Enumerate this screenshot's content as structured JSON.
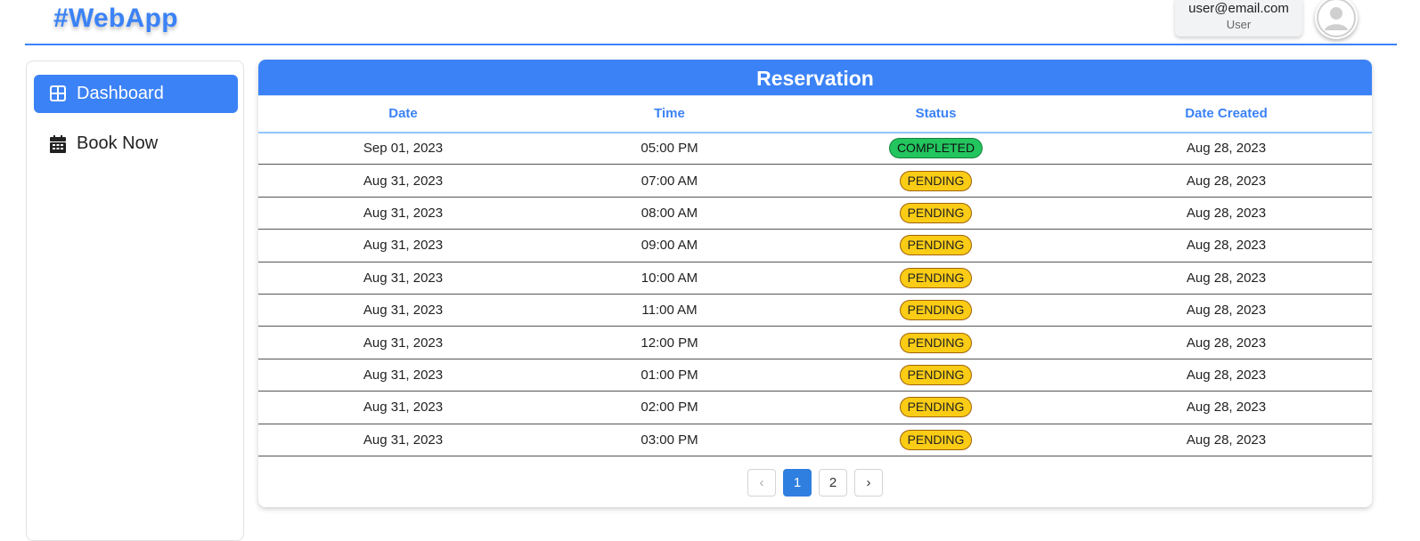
{
  "app": {
    "logo": "#WebApp"
  },
  "user": {
    "email": "user@email.com",
    "role": "User"
  },
  "sidebar": {
    "items": [
      {
        "label": "Dashboard",
        "icon": "dashboard-icon",
        "active": true
      },
      {
        "label": "Book Now",
        "icon": "calendar-icon",
        "active": false
      }
    ]
  },
  "panel": {
    "title": "Reservation"
  },
  "table": {
    "columns": [
      "Date",
      "Time",
      "Status",
      "Date Created"
    ],
    "rows": [
      {
        "date": "Sep 01, 2023",
        "time": "05:00 PM",
        "status": "COMPLETED",
        "created": "Aug 28, 2023"
      },
      {
        "date": "Aug 31, 2023",
        "time": "07:00 AM",
        "status": "PENDING",
        "created": "Aug 28, 2023"
      },
      {
        "date": "Aug 31, 2023",
        "time": "08:00 AM",
        "status": "PENDING",
        "created": "Aug 28, 2023"
      },
      {
        "date": "Aug 31, 2023",
        "time": "09:00 AM",
        "status": "PENDING",
        "created": "Aug 28, 2023"
      },
      {
        "date": "Aug 31, 2023",
        "time": "10:00 AM",
        "status": "PENDING",
        "created": "Aug 28, 2023"
      },
      {
        "date": "Aug 31, 2023",
        "time": "11:00 AM",
        "status": "PENDING",
        "created": "Aug 28, 2023"
      },
      {
        "date": "Aug 31, 2023",
        "time": "12:00 PM",
        "status": "PENDING",
        "created": "Aug 28, 2023"
      },
      {
        "date": "Aug 31, 2023",
        "time": "01:00 PM",
        "status": "PENDING",
        "created": "Aug 28, 2023"
      },
      {
        "date": "Aug 31, 2023",
        "time": "02:00 PM",
        "status": "PENDING",
        "created": "Aug 28, 2023"
      },
      {
        "date": "Aug 31, 2023",
        "time": "03:00 PM",
        "status": "PENDING",
        "created": "Aug 28, 2023"
      }
    ]
  },
  "pagination": {
    "prev": "‹",
    "pages": [
      "1",
      "2"
    ],
    "current": "1",
    "next": "›"
  },
  "colors": {
    "accent": "#3b82f6",
    "completed": "#22c55e",
    "pending": "#facc15"
  }
}
